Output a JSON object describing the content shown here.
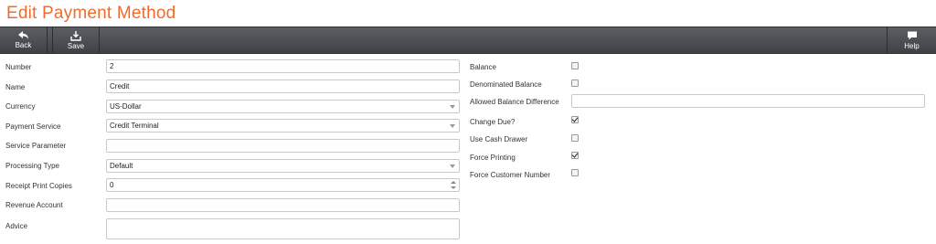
{
  "title": "Edit Payment Method",
  "toolbar": {
    "back": "Back",
    "save": "Save",
    "help": "Help"
  },
  "left": {
    "number": {
      "label": "Number",
      "value": "2"
    },
    "name": {
      "label": "Name",
      "value": "Credit"
    },
    "currency": {
      "label": "Currency",
      "value": "US-Dollar"
    },
    "payment_service": {
      "label": "Payment Service",
      "value": "Credit Terminal"
    },
    "service_parameter": {
      "label": "Service Parameter",
      "value": ""
    },
    "processing_type": {
      "label": "Processing Type",
      "value": "Default"
    },
    "receipt_print_copies": {
      "label": "Receipt Print Copies",
      "value": "0"
    },
    "revenue_account": {
      "label": "Revenue Account",
      "value": ""
    },
    "advice": {
      "label": "Advice",
      "value": ""
    }
  },
  "right": {
    "balance": {
      "label": "Balance",
      "checked": false
    },
    "denominated_balance": {
      "label": "Denominated Balance",
      "checked": false
    },
    "allowed_balance_difference": {
      "label": "Allowed Balance Difference",
      "value": ""
    },
    "change_due": {
      "label": "Change Due?",
      "checked": true
    },
    "use_cash_drawer": {
      "label": "Use Cash Drawer",
      "checked": false
    },
    "force_printing": {
      "label": "Force Printing",
      "checked": true
    },
    "force_customer_number": {
      "label": "Force Customer Number",
      "checked": false
    }
  }
}
